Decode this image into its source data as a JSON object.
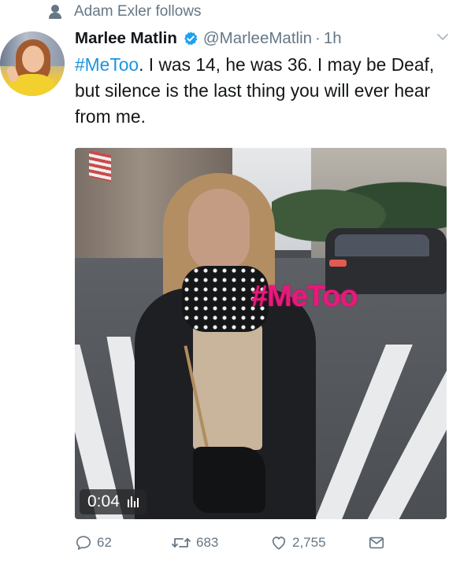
{
  "context": {
    "text": "Adam Exler follows"
  },
  "tweet": {
    "display_name": "Marlee Matlin",
    "handle": "@MarleeMatlin",
    "dot": "·",
    "time": "1h",
    "text_hashtag": "#MeToo",
    "text_body": ". I was 14, he was 36. I may be Deaf, but silence is the last thing you will ever hear from me."
  },
  "video": {
    "overlay_hashtag": "#MeToo",
    "duration": "0:04"
  },
  "actions": {
    "replies": "62",
    "retweets": "683",
    "likes": "2,755"
  },
  "colors": {
    "link_blue": "#1b95e0",
    "verified_blue": "#1da1f2",
    "secondary_gray": "#657786",
    "overlay_pink": "#e9187c"
  },
  "icons": [
    "person-icon",
    "verified-icon",
    "chevron-down-icon",
    "audio-bars-icon",
    "reply-icon",
    "retweet-icon",
    "like-icon",
    "message-icon"
  ]
}
